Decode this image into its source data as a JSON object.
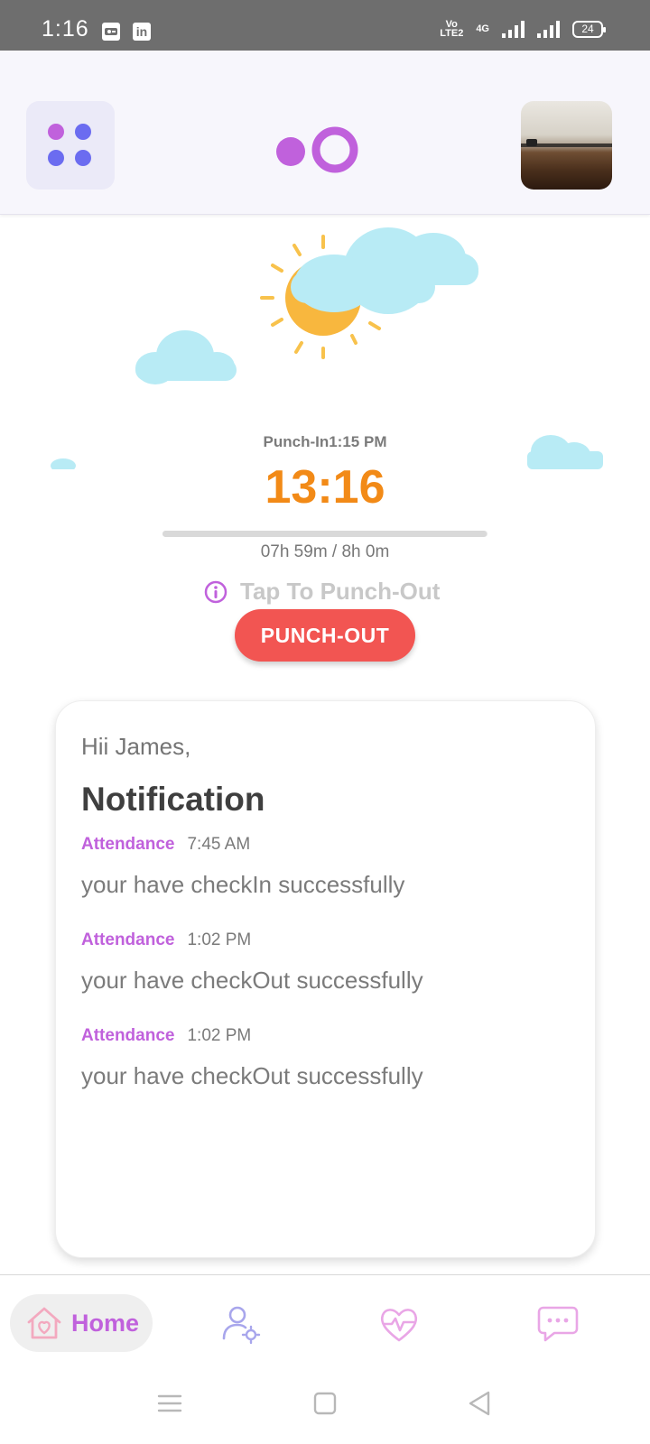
{
  "status_bar": {
    "time": "1:16",
    "notification_icons": [
      "screen-recorder-icon",
      "linkedin-icon"
    ],
    "linkedin_glyph": "in",
    "volte_text": "VoLTE2",
    "network": "4G",
    "battery": "24"
  },
  "header": {
    "menu_icon": "grid-dots-icon",
    "logo": "app-logo",
    "avatar": "profile-avatar"
  },
  "punch": {
    "punch_in_label": "Punch-In1:15 PM",
    "clock": "13:16",
    "hours_text": "07h 59m / 8h 0m",
    "progress_fraction": 0.998,
    "hint": "Tap To Punch-Out",
    "button_label": "PUNCH-OUT"
  },
  "notifications_card": {
    "greeting": "Hii James,",
    "title": "Notification",
    "items": [
      {
        "category": "Attendance",
        "time": "7:45 AM",
        "message": "your have checkIn successfully"
      },
      {
        "category": "Attendance",
        "time": "1:02 PM",
        "message": "your have checkOut successfully"
      },
      {
        "category": "Attendance",
        "time": "1:02 PM",
        "message": "your have checkOut successfully"
      }
    ]
  },
  "bottom_nav": {
    "home_label": "Home",
    "items": [
      "home-icon",
      "user-settings-icon",
      "heart-pulse-icon",
      "chat-icon"
    ]
  },
  "colors": {
    "accent": "#c061dc",
    "secondary": "#6b6cf0",
    "clock": "#f28a17",
    "punch_button": "#f25552"
  }
}
